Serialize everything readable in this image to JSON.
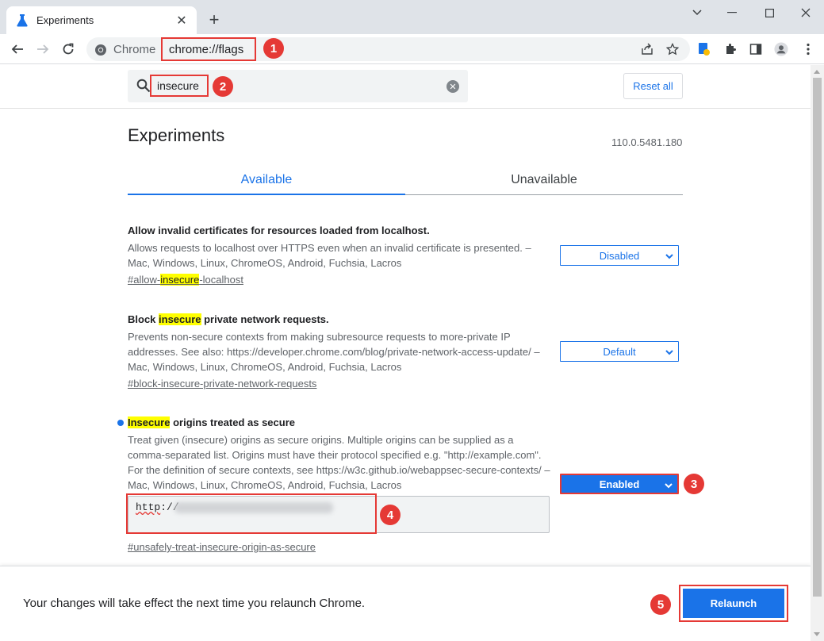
{
  "browser": {
    "tab_title": "Experiments",
    "site_chip": "Chrome",
    "url": "chrome://flags"
  },
  "search": {
    "query": "insecure"
  },
  "header": {
    "reset_label": "Reset all"
  },
  "main": {
    "title": "Experiments",
    "version": "110.0.5481.180",
    "tabs": [
      "Available",
      "Unavailable"
    ]
  },
  "experiments": [
    {
      "name_pre": "Allow invalid certificates for resources loaded from localhost.",
      "desc": "Allows requests to localhost over HTTPS even when an invalid certificate is presented. – Mac, Windows, Linux, ChromeOS, Android, Fuchsia, Lacros",
      "link_pre": "#allow-",
      "link_hl": "insecure",
      "link_post": "-localhost",
      "value": "Disabled"
    },
    {
      "name_pre": "Block ",
      "name_hl": "insecure",
      "name_post": " private network requests.",
      "desc": "Prevents non-secure contexts from making subresource requests to more-private IP addresses. See also: https://developer.chrome.com/blog/private-network-access-update/ – Mac, Windows, Linux, ChromeOS, Android, Fuchsia, Lacros",
      "link": "#block-insecure-private-network-requests",
      "value": "Default"
    },
    {
      "name_hl": "Insecure",
      "name_post": " origins treated as secure",
      "desc": "Treat given (insecure) origins as secure origins. Multiple origins can be supplied as a comma-separated list. Origins must have their protocol specified e.g. \"http://example.com\". For the definition of secure contexts, see https://w3c.github.io/webappsec-secure-contexts/ – Mac, Windows, Linux, ChromeOS, Android, Fuchsia, Lacros",
      "textarea_scheme": "http",
      "textarea_rest": "://",
      "link": "#unsafely-treat-insecure-origin-as-secure",
      "value": "Enabled"
    }
  ],
  "footer": {
    "message": "Your changes will take effect the next time you relaunch Chrome.",
    "relaunch_label": "Relaunch"
  },
  "annotations": [
    "1",
    "2",
    "3",
    "4",
    "5"
  ],
  "colors": {
    "accent": "#1a73e8",
    "annotation": "#e53935",
    "highlight": "#ffff00"
  }
}
